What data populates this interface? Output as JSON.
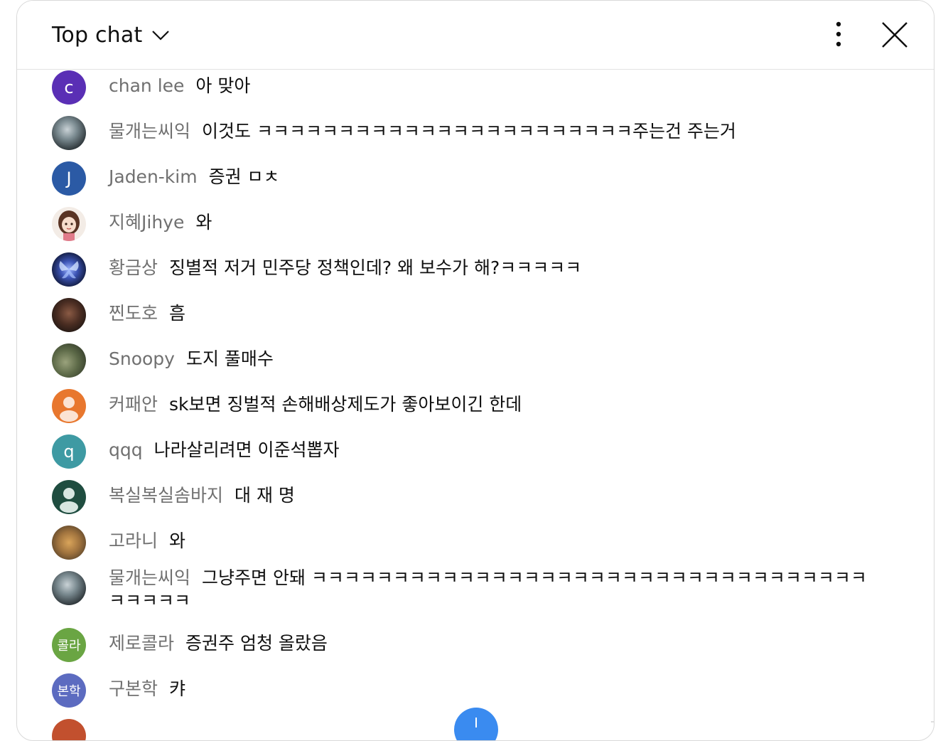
{
  "header": {
    "title": "Top chat"
  },
  "colors": {
    "author_text": "#707070",
    "message_text": "#0f0f0f",
    "fab_blue": "#3a8bf0"
  },
  "messages": [
    {
      "author": "chan lee",
      "text": "아 맞아",
      "avatar_letter": "c",
      "avatar_color": "#5a2fb5"
    },
    {
      "author": "물개는씨익",
      "text": "이것도 ㅋㅋㅋㅋㅋㅋㅋㅋㅋㅋㅋㅋㅋㅋㅋㅋㅋㅋㅋㅋㅋㅋㅋ주는건 주는거",
      "avatar_letter": "",
      "avatar_color": "#4a5560"
    },
    {
      "author": "Jaden-kim",
      "text": "증권 ㅁㅊ",
      "avatar_letter": "J",
      "avatar_color": "#2b5aa5"
    },
    {
      "author": "지혜Jihye",
      "text": "와",
      "avatar_letter": "",
      "avatar_color": "#f3ece6"
    },
    {
      "author": "황금상",
      "text": "징별적 저거 민주당 정책인데? 왜 보수가 해?ㅋㅋㅋㅋㅋ",
      "avatar_letter": "",
      "avatar_color": "#1b2850"
    },
    {
      "author": "찐도호",
      "text": "흠",
      "avatar_letter": "",
      "avatar_color": "#3a2a24"
    },
    {
      "author": "Snoopy",
      "text": "도지 풀매수",
      "avatar_letter": "",
      "avatar_color": "#5d6a48"
    },
    {
      "author": "커패안",
      "text": "sk보면 징벌적 손해배상제도가 좋아보이긴 한데",
      "avatar_letter": "",
      "avatar_color": "#e8772e"
    },
    {
      "author": "qqq",
      "text": "나라살리려면 이준석뽑자",
      "avatar_letter": "q",
      "avatar_color": "#3e9aa3"
    },
    {
      "author": "복실복실솜바지",
      "text": "대 재 명",
      "avatar_letter": "",
      "avatar_color": "#1f4d40"
    },
    {
      "author": "고라니",
      "text": "와",
      "avatar_letter": "",
      "avatar_color": "#a0733e"
    },
    {
      "author": "물개는씨익",
      "text": "그냥주면 안돼 ㅋㅋㅋㅋㅋㅋㅋㅋㅋㅋㅋㅋㅋㅋㅋㅋㅋㅋㅋㅋㅋㅋㅋㅋㅋㅋㅋㅋㅋㅋㅋㅋㅋㅋㅋㅋㅋㅋㅋ",
      "avatar_letter": "",
      "avatar_color": "#4a5560"
    },
    {
      "author": "제로콜라",
      "text": "증권주 엄청 올랐음",
      "avatar_letter": "콜라",
      "avatar_color": "#6aa543"
    },
    {
      "author": "구본학",
      "text": "캬",
      "avatar_letter": "본학",
      "avatar_color": "#5c6bc0"
    }
  ]
}
